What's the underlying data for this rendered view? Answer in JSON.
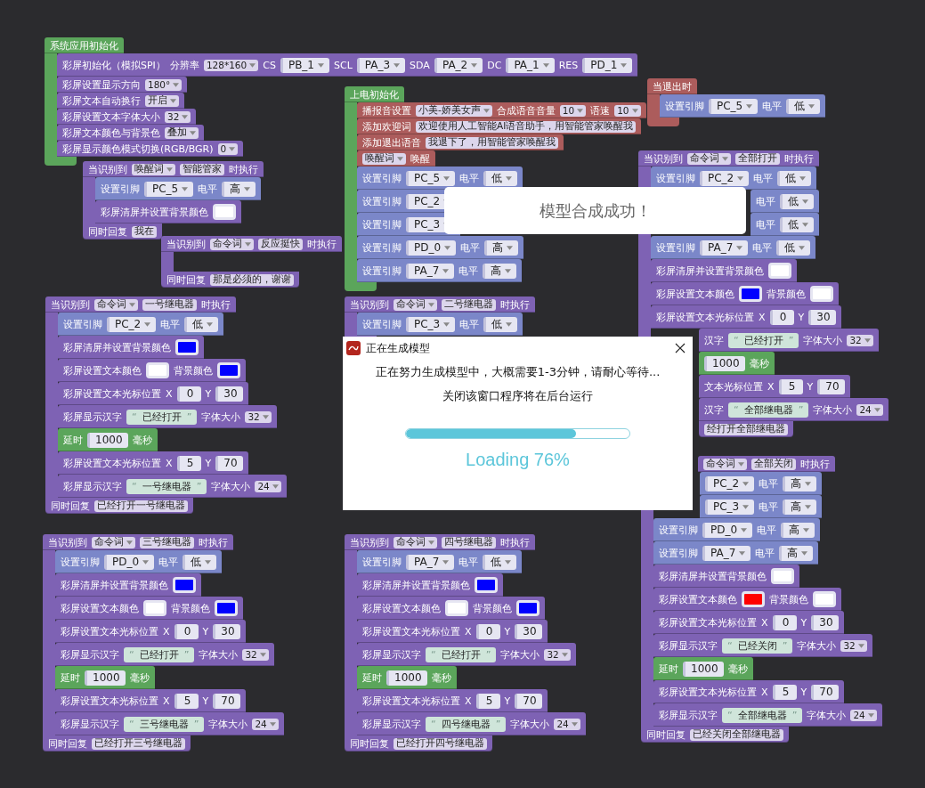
{
  "stacks": [
    {
      "color": "#5ba55b",
      "hat": {
        "parts": [
          {
            "kind": "label",
            "text": "系统应用初始化"
          }
        ]
      },
      "body": [
        {
          "color": "#7e62b4",
          "parts": [
            {
              "kind": "label",
              "text": "彩屏初始化（模拟SPI）"
            },
            {
              "kind": "label",
              "text": "分辨率"
            },
            {
              "kind": "menu",
              "text": "128*160"
            },
            {
              "kind": "label",
              "text": "CS"
            },
            {
              "kind": "pin",
              "text": "PB_1"
            },
            {
              "kind": "label",
              "text": "SCL"
            },
            {
              "kind": "pin",
              "text": "PA_3"
            },
            {
              "kind": "label",
              "text": "SDA"
            },
            {
              "kind": "pin",
              "text": "PA_2"
            },
            {
              "kind": "label",
              "text": "DC"
            },
            {
              "kind": "pin",
              "text": "PA_1"
            },
            {
              "kind": "label",
              "text": "RES"
            },
            {
              "kind": "pin",
              "text": "PD_1"
            }
          ]
        },
        {
          "color": "#7e62b4",
          "parts": [
            {
              "kind": "label",
              "text": "彩屏设置显示方向"
            },
            {
              "kind": "menu",
              "text": "180°"
            }
          ]
        },
        {
          "color": "#7e62b4",
          "parts": [
            {
              "kind": "label",
              "text": "彩屏文本自动换行"
            },
            {
              "kind": "menu",
              "text": "开启"
            }
          ]
        },
        {
          "color": "#7e62b4",
          "parts": [
            {
              "kind": "label",
              "text": "彩屏设置文本字体大小"
            },
            {
              "kind": "menu",
              "text": "32"
            }
          ]
        },
        {
          "color": "#7e62b4",
          "parts": [
            {
              "kind": "label",
              "text": "彩屏文本颜色与背景色"
            },
            {
              "kind": "menu",
              "text": "叠加"
            }
          ]
        },
        {
          "color": "#7e62b4",
          "parts": [
            {
              "kind": "label",
              "text": "彩屏显示颜色模式切换(RGB/BGR)"
            },
            {
              "kind": "menu",
              "text": "0"
            }
          ]
        }
      ]
    },
    {
      "color": "#7e62b4",
      "hat": {
        "parts": [
          {
            "kind": "label",
            "text": "当识别到"
          },
          {
            "kind": "menu",
            "text": "唤醒词"
          },
          {
            "kind": "box",
            "text": "智能管家"
          },
          {
            "kind": "label",
            "text": "时执行"
          }
        ]
      },
      "body": [
        {
          "color": "#7b87c9",
          "parts": [
            {
              "kind": "label",
              "text": "设置引脚"
            },
            {
              "kind": "pin",
              "text": "PC_5"
            },
            {
              "kind": "label",
              "text": "电平"
            },
            {
              "kind": "pin",
              "text": "高"
            }
          ]
        },
        {
          "color": "#7e62b4",
          "parts": [
            {
              "kind": "label",
              "text": "彩屏清屏并设置背景颜色"
            },
            {
              "kind": "swatch",
              "color": "#ffffff"
            }
          ]
        }
      ],
      "footer": {
        "parts": [
          {
            "kind": "label",
            "text": "同时回复"
          },
          {
            "kind": "box",
            "text": "我在"
          }
        ]
      }
    },
    {
      "color": "#7e62b4",
      "hat": {
        "parts": [
          {
            "kind": "label",
            "text": "当识别到"
          },
          {
            "kind": "menu",
            "text": "命令词"
          },
          {
            "kind": "box",
            "text": "反应挺快"
          },
          {
            "kind": "label",
            "text": "时执行"
          }
        ]
      },
      "footer": {
        "parts": [
          {
            "kind": "label",
            "text": "同时回复"
          },
          {
            "kind": "box",
            "text": "那是必须的，谢谢"
          }
        ]
      }
    },
    {
      "color": "#5ba55b",
      "hat": {
        "parts": [
          {
            "kind": "label",
            "text": "上电初始化"
          }
        ]
      },
      "body": [
        {
          "color": "#ac5c5c",
          "parts": [
            {
              "kind": "label",
              "text": "播报音设置"
            },
            {
              "kind": "menu",
              "text": "小美-娇美女声"
            },
            {
              "kind": "label",
              "text": "合成语音音量"
            },
            {
              "kind": "menu",
              "text": "10"
            },
            {
              "kind": "label",
              "text": "语速"
            },
            {
              "kind": "menu",
              "text": "10"
            }
          ]
        },
        {
          "color": "#ac5c5c",
          "parts": [
            {
              "kind": "label",
              "text": "添加欢迎词"
            },
            {
              "kind": "box",
              "text": "欢迎使用人工智能AI语音助手，用智能管家唤醒我"
            }
          ]
        },
        {
          "color": "#ac5c5c",
          "parts": [
            {
              "kind": "label",
              "text": "添加退出语音"
            },
            {
              "kind": "box",
              "text": "我退下了，用智能管家唤醒我"
            }
          ]
        },
        {
          "color": "#ac5c5c",
          "parts": [
            {
              "kind": "menu",
              "text": "唤醒词"
            },
            {
              "kind": "label",
              "text": "唤醒"
            }
          ]
        },
        {
          "color": "#7b87c9",
          "parts": [
            {
              "kind": "label",
              "text": "设置引脚"
            },
            {
              "kind": "pin",
              "text": "PC_5"
            },
            {
              "kind": "label",
              "text": "电平"
            },
            {
              "kind": "pin",
              "text": "低"
            }
          ]
        },
        {
          "color": "#7b87c9",
          "parts": [
            {
              "kind": "label",
              "text": "设置引脚"
            },
            {
              "kind": "pin",
              "text": "PC_2"
            }
          ]
        },
        {
          "color": "#7b87c9",
          "parts": [
            {
              "kind": "label",
              "text": "设置引脚"
            },
            {
              "kind": "pin",
              "text": "PC_3"
            }
          ]
        },
        {
          "color": "#7b87c9",
          "parts": [
            {
              "kind": "label",
              "text": "设置引脚"
            },
            {
              "kind": "pin",
              "text": "PD_0"
            },
            {
              "kind": "label",
              "text": "电平"
            },
            {
              "kind": "pin",
              "text": "高"
            }
          ]
        },
        {
          "color": "#7b87c9",
          "parts": [
            {
              "kind": "label",
              "text": "设置引脚"
            },
            {
              "kind": "pin",
              "text": "PA_7"
            },
            {
              "kind": "label",
              "text": "电平"
            },
            {
              "kind": "pin",
              "text": "高"
            }
          ]
        }
      ]
    },
    {
      "color": "#ac5c5c",
      "hat": {
        "parts": [
          {
            "kind": "label",
            "text": "当退出时"
          }
        ]
      },
      "body": [
        {
          "color": "#7b87c9",
          "parts": [
            {
              "kind": "label",
              "text": "设置引脚"
            },
            {
              "kind": "pin",
              "text": "PC_5"
            },
            {
              "kind": "label",
              "text": "电平"
            },
            {
              "kind": "pin",
              "text": "低"
            }
          ]
        }
      ]
    },
    {
      "color": "#7e62b4",
      "hat": {
        "parts": [
          {
            "kind": "label",
            "text": "当识别到"
          },
          {
            "kind": "menu",
            "text": "命令词"
          },
          {
            "kind": "box",
            "text": "全部打开"
          },
          {
            "kind": "label",
            "text": "时执行"
          }
        ]
      },
      "body": [
        {
          "color": "#7b87c9",
          "parts": [
            {
              "kind": "label",
              "text": "设置引脚"
            },
            {
              "kind": "pin",
              "text": "PC_2"
            },
            {
              "kind": "label",
              "text": "电平"
            },
            {
              "kind": "pin",
              "text": "低"
            }
          ]
        },
        {
          "color": "#7b87c9",
          "parts": [
            {
              "kind": "label",
              "text": "电平"
            },
            {
              "kind": "pin",
              "text": "低"
            }
          ]
        },
        {
          "color": "#7b87c9",
          "parts": [
            {
              "kind": "label",
              "text": "电平"
            },
            {
              "kind": "pin",
              "text": "低"
            }
          ]
        },
        {
          "color": "#7b87c9",
          "parts": [
            {
              "kind": "label",
              "text": "设置引脚"
            },
            {
              "kind": "pin",
              "text": "PA_7"
            },
            {
              "kind": "label",
              "text": "电平"
            },
            {
              "kind": "pin",
              "text": "低"
            }
          ]
        },
        {
          "color": "#7e62b4",
          "parts": [
            {
              "kind": "label",
              "text": "彩屏清屏并设置背景颜色"
            },
            {
              "kind": "swatch",
              "color": "#ffffff"
            }
          ]
        },
        {
          "color": "#7e62b4",
          "parts": [
            {
              "kind": "label",
              "text": "彩屏设置文本颜色"
            },
            {
              "kind": "swatch",
              "color": "#0000ff"
            },
            {
              "kind": "label",
              "text": "背景颜色"
            },
            {
              "kind": "swatch",
              "color": "#ffffff"
            }
          ]
        },
        {
          "color": "#7e62b4",
          "parts": [
            {
              "kind": "label",
              "text": "彩屏设置文本光标位置"
            },
            {
              "kind": "label",
              "text": "X"
            },
            {
              "kind": "number",
              "text": "0"
            },
            {
              "kind": "label",
              "text": "Y"
            },
            {
              "kind": "number",
              "text": "30"
            }
          ]
        },
        {
          "color": "#7e62b4",
          "parts": [
            {
              "kind": "label",
              "text": "汉字"
            },
            {
              "kind": "string",
              "open": "“",
              "text": "已经打开",
              "close": "”"
            },
            {
              "kind": "label",
              "text": "字体大小"
            },
            {
              "kind": "menu",
              "text": "32"
            }
          ]
        },
        {
          "color": "#5ba55b",
          "parts": [
            {
              "kind": "number",
              "text": "1000"
            },
            {
              "kind": "label",
              "text": "毫秒"
            }
          ]
        },
        {
          "color": "#7e62b4",
          "parts": [
            {
              "kind": "label",
              "text": "文本光标位置"
            },
            {
              "kind": "label",
              "text": "X"
            },
            {
              "kind": "number",
              "text": "5"
            },
            {
              "kind": "label",
              "text": "Y"
            },
            {
              "kind": "number",
              "text": "70"
            }
          ]
        },
        {
          "color": "#7e62b4",
          "parts": [
            {
              "kind": "label",
              "text": "汉字"
            },
            {
              "kind": "string",
              "open": "“",
              "text": "全部继电器",
              "close": "”"
            },
            {
              "kind": "label",
              "text": "字体大小"
            },
            {
              "kind": "menu",
              "text": "24"
            }
          ]
        }
      ],
      "footer": {
        "parts": [
          {
            "kind": "box",
            "text": "经打开全部继电器"
          }
        ]
      }
    },
    {
      "color": "#7e62b4",
      "hat": {
        "parts": [
          {
            "kind": "label",
            "text": "当识别到"
          },
          {
            "kind": "menu",
            "text": "命令词"
          },
          {
            "kind": "box",
            "text": "一号继电器"
          },
          {
            "kind": "label",
            "text": "时执行"
          }
        ]
      },
      "body": [
        {
          "color": "#7b87c9",
          "parts": [
            {
              "kind": "label",
              "text": "设置引脚"
            },
            {
              "kind": "pin",
              "text": "PC_2"
            },
            {
              "kind": "label",
              "text": "电平"
            },
            {
              "kind": "pin",
              "text": "低"
            }
          ]
        },
        {
          "color": "#7e62b4",
          "parts": [
            {
              "kind": "label",
              "text": "彩屏清屏并设置背景颜色"
            },
            {
              "kind": "swatch",
              "color": "#0000ff"
            }
          ]
        },
        {
          "color": "#7e62b4",
          "parts": [
            {
              "kind": "label",
              "text": "彩屏设置文本颜色"
            },
            {
              "kind": "swatch",
              "color": "#ffffff"
            },
            {
              "kind": "label",
              "text": "背景颜色"
            },
            {
              "kind": "swatch",
              "color": "#0000ff"
            }
          ]
        },
        {
          "color": "#7e62b4",
          "parts": [
            {
              "kind": "label",
              "text": "彩屏设置文本光标位置"
            },
            {
              "kind": "label",
              "text": "X"
            },
            {
              "kind": "number",
              "text": "0"
            },
            {
              "kind": "label",
              "text": "Y"
            },
            {
              "kind": "number",
              "text": "30"
            }
          ]
        },
        {
          "color": "#7e62b4",
          "parts": [
            {
              "kind": "label",
              "text": "彩屏显示汉字"
            },
            {
              "kind": "string",
              "open": "“",
              "text": "已经打开",
              "close": "”"
            },
            {
              "kind": "label",
              "text": "字体大小"
            },
            {
              "kind": "menu",
              "text": "32"
            }
          ]
        },
        {
          "color": "#5ba55b",
          "parts": [
            {
              "kind": "label",
              "text": "延时"
            },
            {
              "kind": "number",
              "text": "1000"
            },
            {
              "kind": "label",
              "text": "毫秒"
            }
          ]
        },
        {
          "color": "#7e62b4",
          "parts": [
            {
              "kind": "label",
              "text": "彩屏设置文本光标位置"
            },
            {
              "kind": "label",
              "text": "X"
            },
            {
              "kind": "number",
              "text": "5"
            },
            {
              "kind": "label",
              "text": "Y"
            },
            {
              "kind": "number",
              "text": "70"
            }
          ]
        },
        {
          "color": "#7e62b4",
          "parts": [
            {
              "kind": "label",
              "text": "彩屏显示汉字"
            },
            {
              "kind": "string",
              "open": "“",
              "text": "一号继电器",
              "close": "”"
            },
            {
              "kind": "label",
              "text": "字体大小"
            },
            {
              "kind": "menu",
              "text": "24"
            }
          ]
        }
      ],
      "footer": {
        "parts": [
          {
            "kind": "label",
            "text": "同时回复"
          },
          {
            "kind": "box",
            "text": "已经打开一号继电器"
          }
        ]
      }
    },
    {
      "color": "#7e62b4",
      "hat": {
        "parts": [
          {
            "kind": "label",
            "text": "当识别到"
          },
          {
            "kind": "menu",
            "text": "命令词"
          },
          {
            "kind": "box",
            "text": "二号继电器"
          },
          {
            "kind": "label",
            "text": "时执行"
          }
        ]
      },
      "body": [
        {
          "color": "#7b87c9",
          "parts": [
            {
              "kind": "label",
              "text": "设置引脚"
            },
            {
              "kind": "pin",
              "text": "PC_3"
            },
            {
              "kind": "label",
              "text": "电平"
            },
            {
              "kind": "pin",
              "text": "低"
            }
          ]
        }
      ]
    },
    {
      "color": "#7e62b4",
      "hat": {
        "parts": [
          {
            "kind": "label",
            "text": "当识别到"
          },
          {
            "kind": "menu",
            "text": "命令词"
          },
          {
            "kind": "box",
            "text": "三号继电器"
          },
          {
            "kind": "label",
            "text": "时执行"
          }
        ]
      },
      "body": [
        {
          "color": "#7b87c9",
          "parts": [
            {
              "kind": "label",
              "text": "设置引脚"
            },
            {
              "kind": "pin",
              "text": "PD_0"
            },
            {
              "kind": "label",
              "text": "电平"
            },
            {
              "kind": "pin",
              "text": "低"
            }
          ]
        },
        {
          "color": "#7e62b4",
          "parts": [
            {
              "kind": "label",
              "text": "彩屏清屏并设置背景颜色"
            },
            {
              "kind": "swatch",
              "color": "#0000ff"
            }
          ]
        },
        {
          "color": "#7e62b4",
          "parts": [
            {
              "kind": "label",
              "text": "彩屏设置文本颜色"
            },
            {
              "kind": "swatch",
              "color": "#ffffff"
            },
            {
              "kind": "label",
              "text": "背景颜色"
            },
            {
              "kind": "swatch",
              "color": "#0000ff"
            }
          ]
        },
        {
          "color": "#7e62b4",
          "parts": [
            {
              "kind": "label",
              "text": "彩屏设置文本光标位置"
            },
            {
              "kind": "label",
              "text": "X"
            },
            {
              "kind": "number",
              "text": "0"
            },
            {
              "kind": "label",
              "text": "Y"
            },
            {
              "kind": "number",
              "text": "30"
            }
          ]
        },
        {
          "color": "#7e62b4",
          "parts": [
            {
              "kind": "label",
              "text": "彩屏显示汉字"
            },
            {
              "kind": "string",
              "open": "“",
              "text": "已经打开",
              "close": "”"
            },
            {
              "kind": "label",
              "text": "字体大小"
            },
            {
              "kind": "menu",
              "text": "32"
            }
          ]
        },
        {
          "color": "#5ba55b",
          "parts": [
            {
              "kind": "label",
              "text": "延时"
            },
            {
              "kind": "number",
              "text": "1000"
            },
            {
              "kind": "label",
              "text": "毫秒"
            }
          ]
        },
        {
          "color": "#7e62b4",
          "parts": [
            {
              "kind": "label",
              "text": "彩屏设置文本光标位置"
            },
            {
              "kind": "label",
              "text": "X"
            },
            {
              "kind": "number",
              "text": "5"
            },
            {
              "kind": "label",
              "text": "Y"
            },
            {
              "kind": "number",
              "text": "70"
            }
          ]
        },
        {
          "color": "#7e62b4",
          "parts": [
            {
              "kind": "label",
              "text": "彩屏显示汉字"
            },
            {
              "kind": "string",
              "open": "“",
              "text": "三号继电器",
              "close": "”"
            },
            {
              "kind": "label",
              "text": "字体大小"
            },
            {
              "kind": "menu",
              "text": "24"
            }
          ]
        }
      ],
      "footer": {
        "parts": [
          {
            "kind": "label",
            "text": "同时回复"
          },
          {
            "kind": "box",
            "text": "已经打开三号继电器"
          }
        ]
      }
    },
    {
      "color": "#7e62b4",
      "hat": {
        "parts": [
          {
            "kind": "label",
            "text": "当识别到"
          },
          {
            "kind": "menu",
            "text": "命令词"
          },
          {
            "kind": "box",
            "text": "四号继电器"
          },
          {
            "kind": "label",
            "text": "时执行"
          }
        ]
      },
      "body": [
        {
          "color": "#7b87c9",
          "parts": [
            {
              "kind": "label",
              "text": "设置引脚"
            },
            {
              "kind": "pin",
              "text": "PA_7"
            },
            {
              "kind": "label",
              "text": "电平"
            },
            {
              "kind": "pin",
              "text": "低"
            }
          ]
        },
        {
          "color": "#7e62b4",
          "parts": [
            {
              "kind": "label",
              "text": "彩屏清屏并设置背景颜色"
            },
            {
              "kind": "swatch",
              "color": "#0000ff"
            }
          ]
        },
        {
          "color": "#7e62b4",
          "parts": [
            {
              "kind": "label",
              "text": "彩屏设置文本颜色"
            },
            {
              "kind": "swatch",
              "color": "#ffffff"
            },
            {
              "kind": "label",
              "text": "背景颜色"
            },
            {
              "kind": "swatch",
              "color": "#0000ff"
            }
          ]
        },
        {
          "color": "#7e62b4",
          "parts": [
            {
              "kind": "label",
              "text": "彩屏设置文本光标位置"
            },
            {
              "kind": "label",
              "text": "X"
            },
            {
              "kind": "number",
              "text": "0"
            },
            {
              "kind": "label",
              "text": "Y"
            },
            {
              "kind": "number",
              "text": "30"
            }
          ]
        },
        {
          "color": "#7e62b4",
          "parts": [
            {
              "kind": "label",
              "text": "彩屏显示汉字"
            },
            {
              "kind": "string",
              "open": "“",
              "text": "已经打开",
              "close": "”"
            },
            {
              "kind": "label",
              "text": "字体大小"
            },
            {
              "kind": "menu",
              "text": "32"
            }
          ]
        },
        {
          "color": "#5ba55b",
          "parts": [
            {
              "kind": "label",
              "text": "延时"
            },
            {
              "kind": "number",
              "text": "1000"
            },
            {
              "kind": "label",
              "text": "毫秒"
            }
          ]
        },
        {
          "color": "#7e62b4",
          "parts": [
            {
              "kind": "label",
              "text": "彩屏设置文本光标位置"
            },
            {
              "kind": "label",
              "text": "X"
            },
            {
              "kind": "number",
              "text": "5"
            },
            {
              "kind": "label",
              "text": "Y"
            },
            {
              "kind": "number",
              "text": "70"
            }
          ]
        },
        {
          "color": "#7e62b4",
          "parts": [
            {
              "kind": "label",
              "text": "彩屏显示汉字"
            },
            {
              "kind": "string",
              "open": "“",
              "text": "四号继电器",
              "close": "”"
            },
            {
              "kind": "label",
              "text": "字体大小"
            },
            {
              "kind": "menu",
              "text": "24"
            }
          ]
        }
      ],
      "footer": {
        "parts": [
          {
            "kind": "label",
            "text": "同时回复"
          },
          {
            "kind": "box",
            "text": "已经打开四号继电器"
          }
        ]
      }
    },
    {
      "color": "#7e62b4",
      "hat": {
        "parts": [
          {
            "kind": "menu",
            "text": "命令词"
          },
          {
            "kind": "box",
            "text": "全部关闭"
          },
          {
            "kind": "label",
            "text": "时执行"
          }
        ]
      },
      "body": [
        {
          "color": "#7b87c9",
          "parts": [
            {
              "kind": "pin",
              "text": "PC_2"
            },
            {
              "kind": "label",
              "text": "电平"
            },
            {
              "kind": "pin",
              "text": "高"
            }
          ]
        },
        {
          "color": "#7b87c9",
          "parts": [
            {
              "kind": "pin",
              "text": "PC_3"
            },
            {
              "kind": "label",
              "text": "电平"
            },
            {
              "kind": "pin",
              "text": "高"
            }
          ]
        },
        {
          "color": "#7b87c9",
          "parts": [
            {
              "kind": "label",
              "text": "设置引脚"
            },
            {
              "kind": "pin",
              "text": "PD_0"
            },
            {
              "kind": "label",
              "text": "电平"
            },
            {
              "kind": "pin",
              "text": "高"
            }
          ]
        },
        {
          "color": "#7b87c9",
          "parts": [
            {
              "kind": "label",
              "text": "设置引脚"
            },
            {
              "kind": "pin",
              "text": "PA_7"
            },
            {
              "kind": "label",
              "text": "电平"
            },
            {
              "kind": "pin",
              "text": "高"
            }
          ]
        },
        {
          "color": "#7e62b4",
          "parts": [
            {
              "kind": "label",
              "text": "彩屏清屏并设置背景颜色"
            },
            {
              "kind": "swatch",
              "color": "#ffffff"
            }
          ]
        },
        {
          "color": "#7e62b4",
          "parts": [
            {
              "kind": "label",
              "text": "彩屏设置文本颜色"
            },
            {
              "kind": "swatch",
              "color": "#ff0000"
            },
            {
              "kind": "label",
              "text": "背景颜色"
            },
            {
              "kind": "swatch",
              "color": "#ffffff"
            }
          ]
        },
        {
          "color": "#7e62b4",
          "parts": [
            {
              "kind": "label",
              "text": "彩屏设置文本光标位置"
            },
            {
              "kind": "label",
              "text": "X"
            },
            {
              "kind": "number",
              "text": "0"
            },
            {
              "kind": "label",
              "text": "Y"
            },
            {
              "kind": "number",
              "text": "30"
            }
          ]
        },
        {
          "color": "#7e62b4",
          "parts": [
            {
              "kind": "label",
              "text": "彩屏显示汉字"
            },
            {
              "kind": "string",
              "open": "“",
              "text": "已经关闭",
              "close": "”"
            },
            {
              "kind": "label",
              "text": "字体大小"
            },
            {
              "kind": "menu",
              "text": "32"
            }
          ]
        },
        {
          "color": "#5ba55b",
          "parts": [
            {
              "kind": "label",
              "text": "延时"
            },
            {
              "kind": "number",
              "text": "1000"
            },
            {
              "kind": "label",
              "text": "毫秒"
            }
          ]
        },
        {
          "color": "#7e62b4",
          "parts": [
            {
              "kind": "label",
              "text": "彩屏设置文本光标位置"
            },
            {
              "kind": "label",
              "text": "X"
            },
            {
              "kind": "number",
              "text": "5"
            },
            {
              "kind": "label",
              "text": "Y"
            },
            {
              "kind": "number",
              "text": "70"
            }
          ]
        },
        {
          "color": "#7e62b4",
          "parts": [
            {
              "kind": "label",
              "text": "彩屏显示汉字"
            },
            {
              "kind": "string",
              "open": "“",
              "text": "全部继电器",
              "close": "”"
            },
            {
              "kind": "label",
              "text": "字体大小"
            },
            {
              "kind": "menu",
              "text": "24"
            }
          ]
        }
      ],
      "footer": {
        "parts": [
          {
            "kind": "label",
            "text": "同时回复"
          },
          {
            "kind": "box",
            "text": "已经关闭全部继电器"
          }
        ]
      }
    }
  ],
  "toast": {
    "text": "模型合成成功！"
  },
  "dialog": {
    "title": "正在生成模型",
    "lines": [
      "正在努力生成模型中，大概需要1-3分钟，请耐心等待...",
      "关闭该窗口程序将在后台运行"
    ],
    "progress": {
      "level": 0.76,
      "label": "Loading 76%"
    }
  }
}
